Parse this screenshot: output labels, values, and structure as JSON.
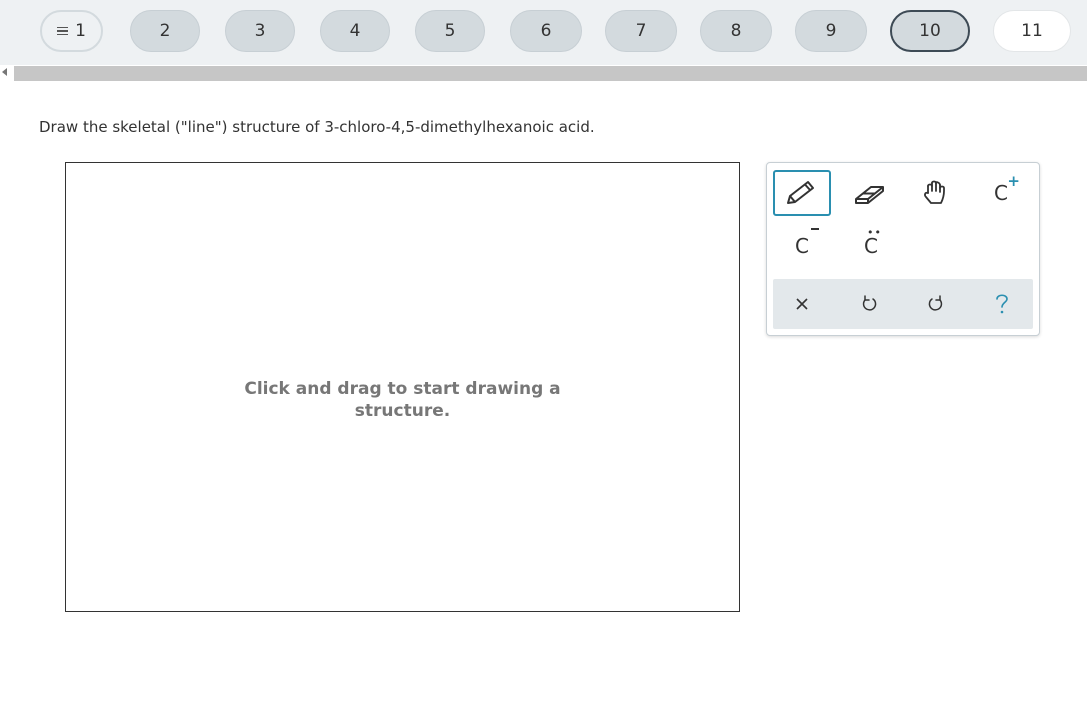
{
  "nav": {
    "questions": [
      {
        "label": "1",
        "state": "first"
      },
      {
        "label": "2",
        "state": "done"
      },
      {
        "label": "3",
        "state": "done"
      },
      {
        "label": "4",
        "state": "done"
      },
      {
        "label": "5",
        "state": "done"
      },
      {
        "label": "6",
        "state": "done"
      },
      {
        "label": "7",
        "state": "done"
      },
      {
        "label": "8",
        "state": "done"
      },
      {
        "label": "9",
        "state": "done"
      },
      {
        "label": "10",
        "state": "active"
      },
      {
        "label": "11",
        "state": "next"
      }
    ]
  },
  "question": {
    "text": "Draw the skeletal (\"line\") structure of 3-chloro-4,5-dimethylhexanoic acid."
  },
  "canvas": {
    "hint": "Click and drag to start drawing a structure."
  },
  "toolbar": {
    "carbon_symbol": "C",
    "cation_sup": "+",
    "colors": {
      "accent": "#2a8fb0",
      "icon": "#333333",
      "actions_bg": "#e3e8eb"
    }
  }
}
